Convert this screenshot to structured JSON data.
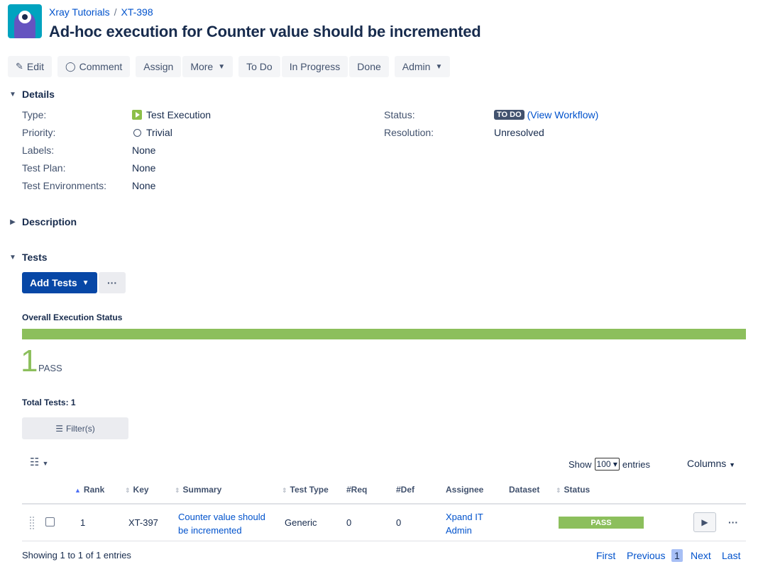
{
  "header": {
    "project": "Xray Tutorials",
    "issue_key": "XT-398",
    "title": "Ad-hoc execution for Counter value should be incremented"
  },
  "toolbar": {
    "edit": "Edit",
    "comment": "Comment",
    "assign": "Assign",
    "more": "More",
    "todo": "To Do",
    "in_progress": "In Progress",
    "done": "Done",
    "admin": "Admin"
  },
  "details": {
    "heading": "Details",
    "type_label": "Type:",
    "type_value": "Test Execution",
    "priority_label": "Priority:",
    "priority_value": "Trivial",
    "labels_label": "Labels:",
    "labels_value": "None",
    "test_plan_label": "Test Plan:",
    "test_plan_value": "None",
    "test_env_label": "Test Environments:",
    "test_env_value": "None",
    "status_label": "Status:",
    "status_value": "TO DO",
    "view_workflow": "(View Workflow)",
    "resolution_label": "Resolution:",
    "resolution_value": "Unresolved"
  },
  "description": {
    "heading": "Description"
  },
  "tests": {
    "heading": "Tests",
    "add_tests": "Add Tests",
    "overall_label": "Overall Execution Status",
    "pass_fraction": 1.0,
    "pass_count": "1",
    "pass_label": "PASS",
    "total_tests": "Total Tests: 1",
    "filters": "Filter(s)",
    "show": "Show",
    "entries_value": "100",
    "entries": "entries",
    "columns": "Columns"
  },
  "table": {
    "headers": {
      "rank": "Rank",
      "key": "Key",
      "summary": "Summary",
      "test_type": "Test Type",
      "req": "#Req",
      "def": "#Def",
      "assignee": "Assignee",
      "dataset": "Dataset",
      "status": "Status"
    },
    "row": {
      "rank": "1",
      "key": "XT-397",
      "summary_line1": "Counter value should",
      "summary_line2": "be incremented",
      "test_type": "Generic",
      "req": "0",
      "def": "0",
      "assignee_line1": "Xpand IT",
      "assignee_line2": "Admin",
      "status": "PASS"
    }
  },
  "footer": {
    "showing": "Showing 1 to 1 of 1 entries",
    "first": "First",
    "previous": "Previous",
    "page": "1",
    "next": "Next",
    "last": "Last"
  },
  "colors": {
    "accent": "#0052cc",
    "pass": "#8cbf5c",
    "primary_button": "#0747a6"
  }
}
